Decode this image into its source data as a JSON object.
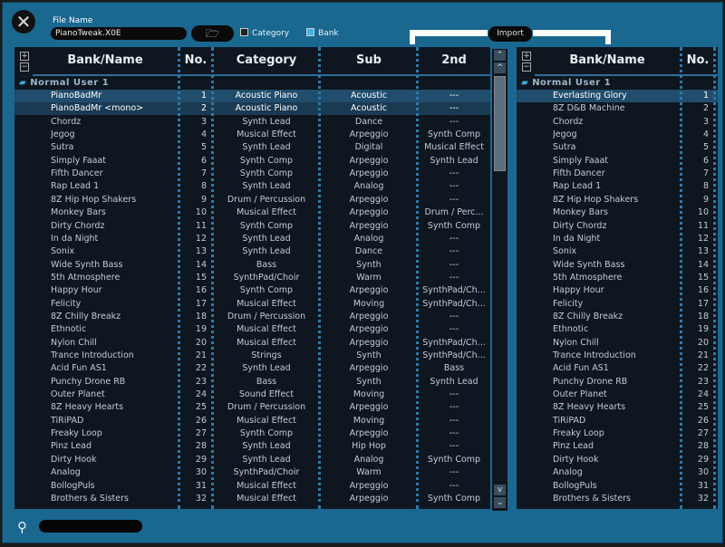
{
  "header": {
    "file_name_label": "File Name",
    "file_name_value": "PianoTweak.X0E",
    "category_label": "Category",
    "category_checked": false,
    "bank_label": "Bank",
    "bank_checked": true,
    "import_label": "Import"
  },
  "icons": {
    "close": "close-icon",
    "folder": "folder-open-icon",
    "search": "search-icon",
    "expand": "plus-icon",
    "collapse": "minus-icon"
  },
  "colors": {
    "background": "#1a6790",
    "panel": "#0e1620",
    "selected_row": "#214d6c",
    "accent": "#3fb6e6"
  },
  "source_table": {
    "columns": [
      "Bank/Name",
      "No.",
      "Category",
      "Sub",
      "2nd"
    ],
    "group": "Normal User 1",
    "rows": [
      [
        "PianoBadMr",
        "1",
        "Acoustic Piano",
        "Acoustic",
        "---"
      ],
      [
        "PianoBadMr <mono>",
        "2",
        "Acoustic Piano",
        "Acoustic",
        "---"
      ],
      [
        "Chordz",
        "3",
        "Synth Lead",
        "Dance",
        "---"
      ],
      [
        "Jegog",
        "4",
        "Musical Effect",
        "Arpeggio",
        "Synth Comp"
      ],
      [
        "Sutra",
        "5",
        "Synth Lead",
        "Digital",
        "Musical Effect"
      ],
      [
        "Simply Faaat",
        "6",
        "Synth Comp",
        "Arpeggio",
        "Synth Lead"
      ],
      [
        "Fifth Dancer",
        "7",
        "Synth Comp",
        "Arpeggio",
        "---"
      ],
      [
        "Rap Lead 1",
        "8",
        "Synth Lead",
        "Analog",
        "---"
      ],
      [
        "8Z Hip Hop Shakers",
        "9",
        "Drum / Percussion",
        "Arpeggio",
        "---"
      ],
      [
        "Monkey Bars",
        "10",
        "Musical Effect",
        "Arpeggio",
        "Drum / Perc..."
      ],
      [
        "Dirty Chordz",
        "11",
        "Synth Comp",
        "Arpeggio",
        "Synth Comp"
      ],
      [
        "In da Night",
        "12",
        "Synth Lead",
        "Analog",
        "---"
      ],
      [
        "Sonix",
        "13",
        "Synth Lead",
        "Dance",
        "---"
      ],
      [
        "Wide Synth Bass",
        "14",
        "Bass",
        "Synth",
        "---"
      ],
      [
        "5th Atmosphere",
        "15",
        "SynthPad/Choir",
        "Warm",
        "---"
      ],
      [
        "Happy Hour",
        "16",
        "Synth Comp",
        "Arpeggio",
        "SynthPad/Ch..."
      ],
      [
        "Felicity",
        "17",
        "Musical Effect",
        "Moving",
        "SynthPad/Ch..."
      ],
      [
        "8Z Chilly Breakz",
        "18",
        "Drum / Percussion",
        "Arpeggio",
        "---"
      ],
      [
        "Ethnotic",
        "19",
        "Musical Effect",
        "Arpeggio",
        "---"
      ],
      [
        "Nylon Chill",
        "20",
        "Musical Effect",
        "Arpeggio",
        "SynthPad/Ch..."
      ],
      [
        "Trance Introduction",
        "21",
        "Strings",
        "Synth",
        "SynthPad/Ch..."
      ],
      [
        "Acid Fun AS1",
        "22",
        "Synth Lead",
        "Arpeggio",
        "Bass"
      ],
      [
        "Punchy Drone RB",
        "23",
        "Bass",
        "Synth",
        "Synth Lead"
      ],
      [
        "Outer Planet",
        "24",
        "Sound Effect",
        "Moving",
        "---"
      ],
      [
        "8Z Heavy Hearts",
        "25",
        "Drum / Percussion",
        "Arpeggio",
        "---"
      ],
      [
        "TiRiPAD",
        "26",
        "Musical Effect",
        "Moving",
        "---"
      ],
      [
        "Freaky Loop",
        "27",
        "Synth Comp",
        "Arpeggio",
        "---"
      ],
      [
        "Pinz Lead",
        "28",
        "Synth Lead",
        "Hip Hop",
        "---"
      ],
      [
        "Dirty Hook",
        "29",
        "Synth Lead",
        "Analog",
        "Synth Comp"
      ],
      [
        "Analog",
        "30",
        "SynthPad/Choir",
        "Warm",
        "---"
      ],
      [
        "BollogPuls",
        "31",
        "Musical Effect",
        "Arpeggio",
        "---"
      ],
      [
        "Brothers & Sisters",
        "32",
        "Musical Effect",
        "Arpeggio",
        "Synth Comp"
      ]
    ]
  },
  "target_table": {
    "columns": [
      "Bank/Name",
      "No."
    ],
    "group": "Normal User 1",
    "rows": [
      [
        "Everlasting Glory",
        "1"
      ],
      [
        "8Z D&B Machine",
        "2"
      ],
      [
        "Chordz",
        "3"
      ],
      [
        "Jegog",
        "4"
      ],
      [
        "Sutra",
        "5"
      ],
      [
        "Simply Faaat",
        "6"
      ],
      [
        "Fifth Dancer",
        "7"
      ],
      [
        "Rap Lead 1",
        "8"
      ],
      [
        "8Z Hip Hop Shakers",
        "9"
      ],
      [
        "Monkey Bars",
        "10"
      ],
      [
        "Dirty Chordz",
        "11"
      ],
      [
        "In da Night",
        "12"
      ],
      [
        "Sonix",
        "13"
      ],
      [
        "Wide Synth Bass",
        "14"
      ],
      [
        "5th Atmosphere",
        "15"
      ],
      [
        "Happy Hour",
        "16"
      ],
      [
        "Felicity",
        "17"
      ],
      [
        "8Z Chilly Breakz",
        "18"
      ],
      [
        "Ethnotic",
        "19"
      ],
      [
        "Nylon Chill",
        "20"
      ],
      [
        "Trance Introduction",
        "21"
      ],
      [
        "Acid Fun AS1",
        "22"
      ],
      [
        "Punchy Drone RB",
        "23"
      ],
      [
        "Outer Planet",
        "24"
      ],
      [
        "8Z Heavy Hearts",
        "25"
      ],
      [
        "TiRiPAD",
        "26"
      ],
      [
        "Freaky Loop",
        "27"
      ],
      [
        "Pinz Lead",
        "28"
      ],
      [
        "Dirty Hook",
        "29"
      ],
      [
        "Analog",
        "30"
      ],
      [
        "BollogPuls",
        "31"
      ],
      [
        "Brothers & Sisters",
        "32"
      ]
    ]
  },
  "search": {
    "value": ""
  }
}
